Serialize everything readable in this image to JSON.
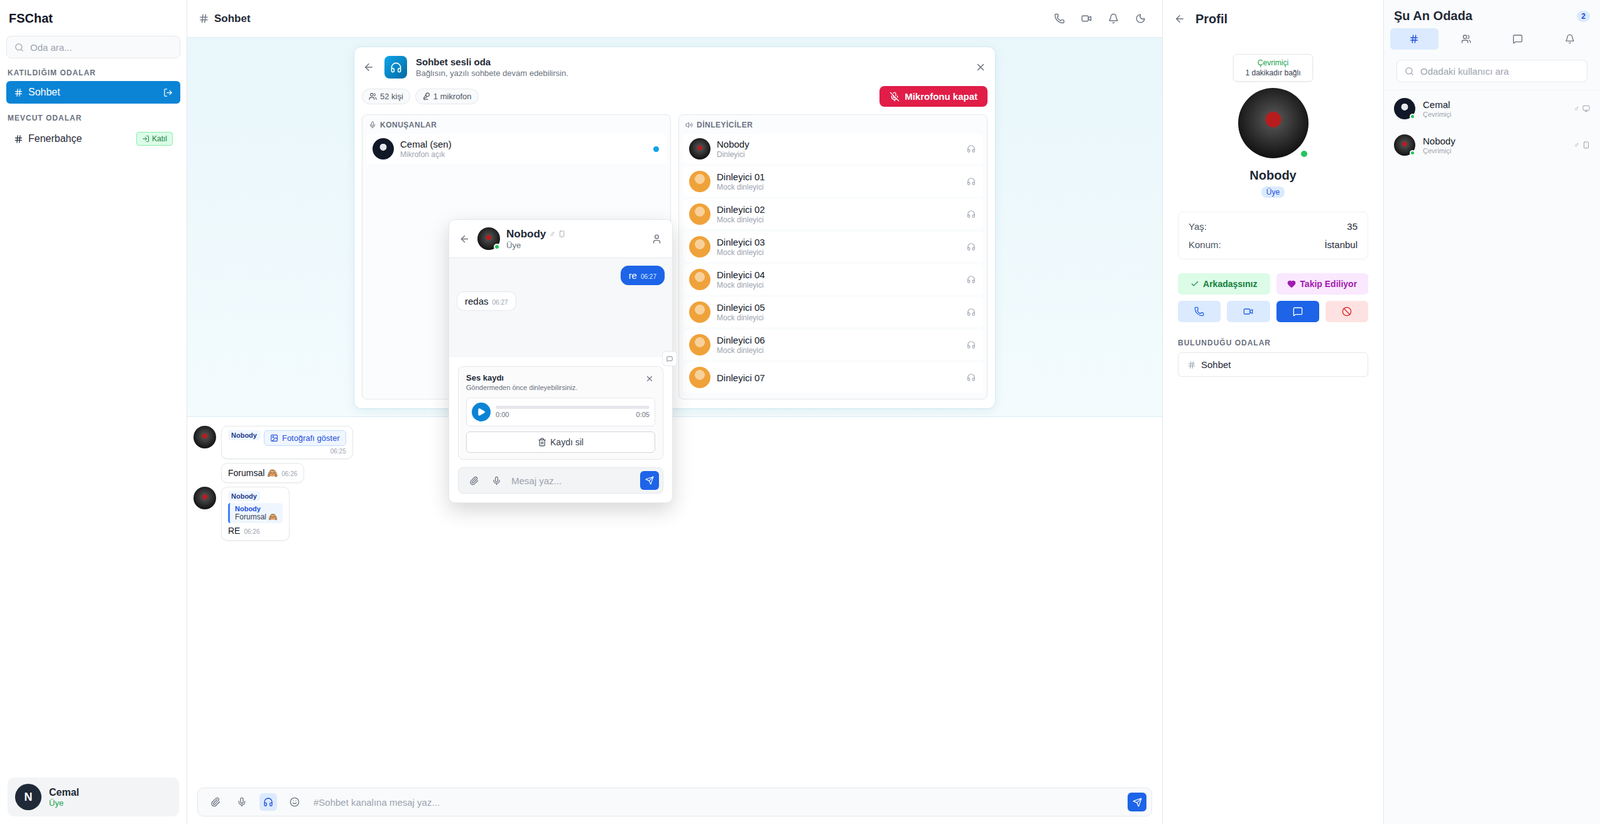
{
  "sidebar": {
    "title": "FSChat",
    "search": {
      "placeholder": "Oda ara..."
    },
    "sections": [
      {
        "label": "KATILDIĞIM ODALAR",
        "rooms": [
          {
            "name": "Sohbet",
            "selected": true
          }
        ]
      },
      {
        "label": "MEVCUT ODALAR",
        "rooms": [
          {
            "name": "Fenerbahçe",
            "selected": false,
            "action": "Katıl"
          }
        ]
      }
    ],
    "user": {
      "initial": "N",
      "name": "Cemal",
      "role": "Üye"
    }
  },
  "header": {
    "title": "Sohbet"
  },
  "voice": {
    "title": "Sohbet sesli oda",
    "subtitle": "Bağlısın, yazılı sohbete devam edebilirsin.",
    "chips": [
      "52 kişi",
      "1 mikrofon"
    ],
    "micButton": "Mikrofonu kapat",
    "speakersLabel": "KONUŞANLAR",
    "speakers": [
      {
        "name": "Cemal (sen)",
        "sub": "Mikrofon açık",
        "speaking": true
      }
    ],
    "listenersLabel": "DİNLEYİCİLER",
    "listeners": [
      {
        "name": "Nobody",
        "sub": "Dinleyici",
        "avatar": "photo"
      },
      {
        "name": "Dinleyici 01",
        "sub": "Mock dinleyici",
        "avatar": "mock"
      },
      {
        "name": "Dinleyici 02",
        "sub": "Mock dinleyici",
        "avatar": "mock"
      },
      {
        "name": "Dinleyici 03",
        "sub": "Mock dinleyici",
        "avatar": "mock"
      },
      {
        "name": "Dinleyici 04",
        "sub": "Mock dinleyici",
        "avatar": "mock"
      },
      {
        "name": "Dinleyici 05",
        "sub": "Mock dinleyici",
        "avatar": "mock"
      },
      {
        "name": "Dinleyici 06",
        "sub": "Mock dinleyici",
        "avatar": "mock"
      },
      {
        "name": "Dinleyici 07",
        "avatar": "mock"
      }
    ]
  },
  "messages": [
    {
      "kind": "photo",
      "author": "Nobody",
      "button": "Fotoğrafı göster",
      "time": "06:25",
      "showAvatar": true
    },
    {
      "kind": "text",
      "text": "Forumsal 🙈",
      "time": "06:26",
      "showAvatar": false
    },
    {
      "kind": "reply",
      "author": "Nobody",
      "replyAuthor": "Nobody",
      "replyText": "Forumsal 🙈",
      "text": "RE",
      "time": "06:26",
      "showAvatar": true
    }
  ],
  "composer": {
    "placeholder": "#Sohbet kanalına mesaj yaz...",
    "voiceActive": true
  },
  "dm": {
    "name": "Nobody",
    "gender": "♂",
    "role": "Üye",
    "online": true,
    "messages": [
      {
        "text": "re",
        "time": "06:27",
        "mine": true
      },
      {
        "text": "redas",
        "time": "06:27",
        "mine": false
      }
    ],
    "recording": {
      "title": "Ses kaydı",
      "subtitle": "Göndermeden önce dinleyebilirsiniz.",
      "current": "0:00",
      "total": "0:05",
      "level": 0,
      "deleteLabel": "Kaydı sil"
    },
    "placeholder": "Mesaj yaz..."
  },
  "profile": {
    "title": "Profil",
    "status": "Çevrimiçi",
    "connected": "1 dakikadır bağlı",
    "name": "Nobody",
    "role": "Üye",
    "online": true,
    "info": [
      {
        "label": "Yaş:",
        "value": "35"
      },
      {
        "label": "Konum:",
        "value": "İstanbul"
      }
    ],
    "friend": "Arkadaşsınız",
    "follow": "Takip Ediliyor",
    "actions": [
      {
        "kind": "phone",
        "selected": false
      },
      {
        "kind": "video",
        "selected": false
      },
      {
        "kind": "message",
        "selected": true
      },
      {
        "kind": "block",
        "selected": false
      }
    ],
    "roomsLabel": "BULUNDUĞU ODALAR",
    "rooms": [
      "Sohbet"
    ]
  },
  "room": {
    "title": "Şu An Odada",
    "count": "2",
    "tabs": [
      {
        "kind": "rooms",
        "selected": true
      },
      {
        "kind": "users",
        "selected": false
      },
      {
        "kind": "messages",
        "selected": false
      },
      {
        "kind": "notifications",
        "selected": false
      }
    ],
    "search": {
      "placeholder": "Odadaki kullanıcı ara"
    },
    "users": [
      {
        "name": "Cemal",
        "status": "Çevrimiçi",
        "online": true,
        "gender": "♂",
        "device": "desktop"
      },
      {
        "name": "Nobody",
        "status": "Çevrimiçi",
        "online": true,
        "gender": "♂",
        "device": "mobile"
      }
    ]
  }
}
